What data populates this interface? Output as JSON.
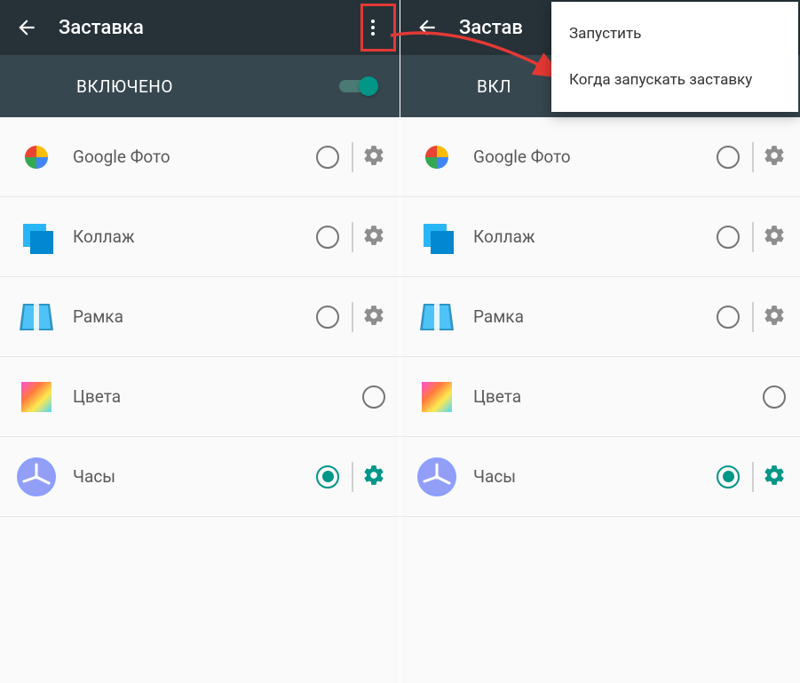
{
  "left": {
    "toolbar": {
      "title": "Заставка"
    },
    "subheader": {
      "label": "ВКЛЮЧЕНО",
      "switch_on": true
    },
    "items": [
      {
        "label": "Google Фото",
        "icon": "google-photos",
        "selected": false,
        "has_settings": true
      },
      {
        "label": "Коллаж",
        "icon": "collage",
        "selected": false,
        "has_settings": true
      },
      {
        "label": "Рамка",
        "icon": "frame",
        "selected": false,
        "has_settings": true
      },
      {
        "label": "Цвета",
        "icon": "colors",
        "selected": false,
        "has_settings": false
      },
      {
        "label": "Часы",
        "icon": "clock",
        "selected": true,
        "has_settings": true
      }
    ]
  },
  "right": {
    "toolbar": {
      "title": "Застав"
    },
    "subheader": {
      "label": "ВКЛ",
      "switch_on": true
    },
    "items": [
      {
        "label": "Google Фото",
        "icon": "google-photos",
        "selected": false,
        "has_settings": true
      },
      {
        "label": "Коллаж",
        "icon": "collage",
        "selected": false,
        "has_settings": true
      },
      {
        "label": "Рамка",
        "icon": "frame",
        "selected": false,
        "has_settings": true
      },
      {
        "label": "Цвета",
        "icon": "colors",
        "selected": false,
        "has_settings": false
      },
      {
        "label": "Часы",
        "icon": "clock",
        "selected": true,
        "has_settings": true
      }
    ],
    "menu": {
      "items": [
        {
          "label": "Запустить"
        },
        {
          "label": "Когда запускать заставку"
        }
      ]
    }
  },
  "colors": {
    "teal": "#009688",
    "gear_gray": "#8e8e8e"
  }
}
